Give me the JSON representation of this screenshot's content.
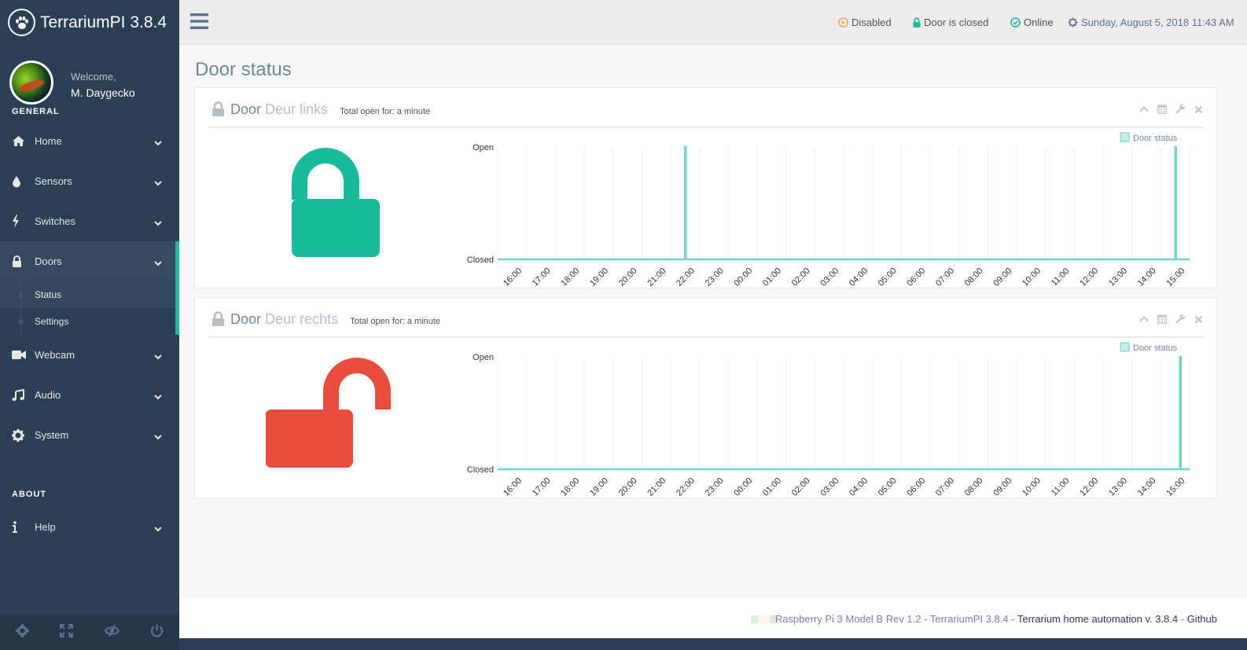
{
  "brand": {
    "title": "TerrariumPI 3.8.4"
  },
  "profile": {
    "welcome": "Welcome,",
    "name": "M. Daygecko"
  },
  "sidebar": {
    "general_title": "GENERAL",
    "about_title": "ABOUT",
    "items": [
      {
        "label": "Home",
        "icon": "home-icon"
      },
      {
        "label": "Sensors",
        "icon": "drop-icon"
      },
      {
        "label": "Switches",
        "icon": "bolt-icon"
      },
      {
        "label": "Doors",
        "icon": "lock-icon"
      },
      {
        "label": "Webcam",
        "icon": "video-camera-icon"
      },
      {
        "label": "Audio",
        "icon": "music-icon"
      },
      {
        "label": "System",
        "icon": "gear-icon"
      },
      {
        "label": "Help",
        "icon": "info-icon"
      }
    ],
    "doors_sub": [
      {
        "label": "Status"
      },
      {
        "label": "Settings"
      }
    ]
  },
  "topnav": {
    "disabled": "Disabled",
    "door_closed": "Door is closed",
    "online": "Online",
    "datetime": "Sunday, August 5, 2018 11:43 AM"
  },
  "page_title": "Door status",
  "panels": [
    {
      "title": "Door",
      "name": "Deur links",
      "total_open": "Total open for: a minute",
      "state": "closed",
      "state_color": "#1abb9c"
    },
    {
      "title": "Door",
      "name": "Deur rechts",
      "total_open": "Total open for: a minute",
      "state": "open",
      "state_color": "#e74c3c"
    }
  ],
  "chart_data": [
    {
      "type": "line",
      "title": "",
      "legend": "Door status",
      "legend_position": "top-right",
      "y_categories": [
        "Closed",
        "Open"
      ],
      "x": [
        "16:00",
        "17:00",
        "18:00",
        "19:00",
        "20:00",
        "21:00",
        "22:00",
        "23:00",
        "00:00",
        "01:00",
        "02:00",
        "03:00",
        "04:00",
        "05:00",
        "06:00",
        "07:00",
        "08:00",
        "09:00",
        "10:00",
        "11:00",
        "12:00",
        "13:00",
        "14:00",
        "15:00"
      ],
      "series": [
        {
          "name": "Door status",
          "open_at": [
            "22:00",
            "15:00"
          ]
        }
      ],
      "color": "#1abb9c"
    },
    {
      "type": "line",
      "title": "",
      "legend": "Door status",
      "legend_position": "top-right",
      "y_categories": [
        "Closed",
        "Open"
      ],
      "x": [
        "16:00",
        "17:00",
        "18:00",
        "19:00",
        "20:00",
        "21:00",
        "22:00",
        "23:00",
        "00:00",
        "01:00",
        "02:00",
        "03:00",
        "04:00",
        "05:00",
        "06:00",
        "07:00",
        "08:00",
        "09:00",
        "10:00",
        "11:00",
        "12:00",
        "13:00",
        "14:00",
        "15:00"
      ],
      "series": [
        {
          "name": "Door status",
          "open_at": [
            "15:10"
          ]
        }
      ],
      "color": "#1abb9c"
    }
  ],
  "footer": {
    "device": "Raspberry Pi 3 Model B Rev 1.2",
    "sep1": " - ",
    "app": "TerrariumPI 3.8.4",
    "sep2": " - ",
    "desc": "Terrarium home automation v. 3.8.4",
    "sep3": " - ",
    "link": "Github"
  }
}
